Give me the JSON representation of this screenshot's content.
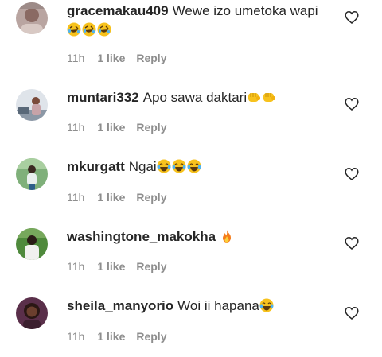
{
  "comments": [
    {
      "username": "gracemakau409",
      "text": "Wewe izo umetoka wapi",
      "emojis": [
        "rofl-emoji",
        "rofl-emoji",
        "rofl-emoji"
      ],
      "time": "11h",
      "likes": "1 like",
      "reply": "Reply"
    },
    {
      "username": "muntari332",
      "text": "Apo sawa daktari",
      "emojis": [
        "fist-bump-emoji",
        "fist-bump-emoji"
      ],
      "time": "11h",
      "likes": "1 like",
      "reply": "Reply"
    },
    {
      "username": "mkurgatt",
      "text": "Ngai",
      "emojis": [
        "tears-of-joy-emoji",
        "tears-of-joy-emoji",
        "tears-of-joy-emoji"
      ],
      "time": "11h",
      "likes": "1 like",
      "reply": "Reply"
    },
    {
      "username": "washingtone_makokha",
      "text": "",
      "emojis": [
        "fire-emoji"
      ],
      "time": "11h",
      "likes": "1 like",
      "reply": "Reply"
    },
    {
      "username": "sheila_manyorio",
      "text": "Woi ii hapana",
      "emojis": [
        "tears-of-joy-emoji"
      ],
      "time": "11h",
      "likes": "1 like",
      "reply": "Reply"
    }
  ],
  "colors": {
    "text": "#262626",
    "meta": "#8e8e8e",
    "heart_outline": "#262626",
    "background": "#ffffff"
  },
  "icons": {
    "like": "heart-outline-icon"
  }
}
